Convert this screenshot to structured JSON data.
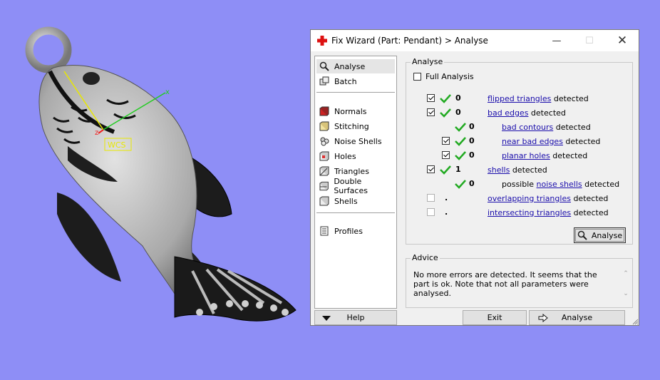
{
  "viewport": {
    "wcs_label": "WCS",
    "axis_labels": {
      "z": "z",
      "x": "x"
    }
  },
  "dialog": {
    "title": "Fix Wizard (Part: Pendant) > Analyse",
    "sidebar": {
      "items_top": [
        {
          "label": "Analyse",
          "icon": "magnifier-icon"
        },
        {
          "label": "Batch",
          "icon": "batch-icon"
        }
      ],
      "items_mid": [
        {
          "label": "Normals",
          "icon": "red-cube-icon"
        },
        {
          "label": "Stitching",
          "icon": "stitching-cube-icon"
        },
        {
          "label": "Noise Shells",
          "icon": "noise-shells-icon"
        },
        {
          "label": "Holes",
          "icon": "holes-cube-icon"
        },
        {
          "label": "Triangles",
          "icon": "triangles-cube-icon"
        },
        {
          "label": "Double Surfaces",
          "icon": "double-surfaces-icon"
        },
        {
          "label": "Shells",
          "icon": "shells-cube-icon"
        }
      ],
      "items_bottom": [
        {
          "label": "Profiles",
          "icon": "profiles-icon"
        }
      ]
    },
    "analyse": {
      "group_label": "Analyse",
      "full_analysis_label": "Full Analysis",
      "full_analysis_checked": false,
      "rows": [
        {
          "checkbox": "checked",
          "ok": true,
          "count": "0",
          "link": "flipped triangles",
          "suffix": " detected"
        },
        {
          "checkbox": "checked",
          "ok": true,
          "count": "0",
          "link": "bad edges",
          "suffix": " detected"
        },
        {
          "checkbox": "none",
          "ok": true,
          "count": "0",
          "link": "bad contours",
          "suffix": " detected"
        },
        {
          "checkbox": "checked",
          "ok": true,
          "count": "0",
          "link": "near bad edges",
          "suffix": " detected"
        },
        {
          "checkbox": "checked",
          "ok": true,
          "count": "0",
          "link": "planar holes",
          "suffix": " detected"
        },
        {
          "checkbox": "checked",
          "ok": true,
          "count": "1",
          "link": "shells",
          "suffix": " detected"
        },
        {
          "checkbox": "none",
          "ok": true,
          "count": "0",
          "prefix": "possible ",
          "link": "noise shells",
          "suffix": " detected"
        },
        {
          "checkbox": "unchecked",
          "ok": false,
          "count": ".",
          "link": "overlapping triangles",
          "suffix": " detected"
        },
        {
          "checkbox": "unchecked",
          "ok": false,
          "count": ".",
          "link": "intersecting triangles",
          "suffix": " detected"
        }
      ],
      "analyse_button": "Analyse"
    },
    "advice": {
      "group_label": "Advice",
      "text": "No more errors are detected. It seems that the part is ok. Note that not all parameters were analysed."
    },
    "bottom": {
      "help": "Help",
      "exit": "Exit",
      "analyse": "Analyse"
    }
  }
}
